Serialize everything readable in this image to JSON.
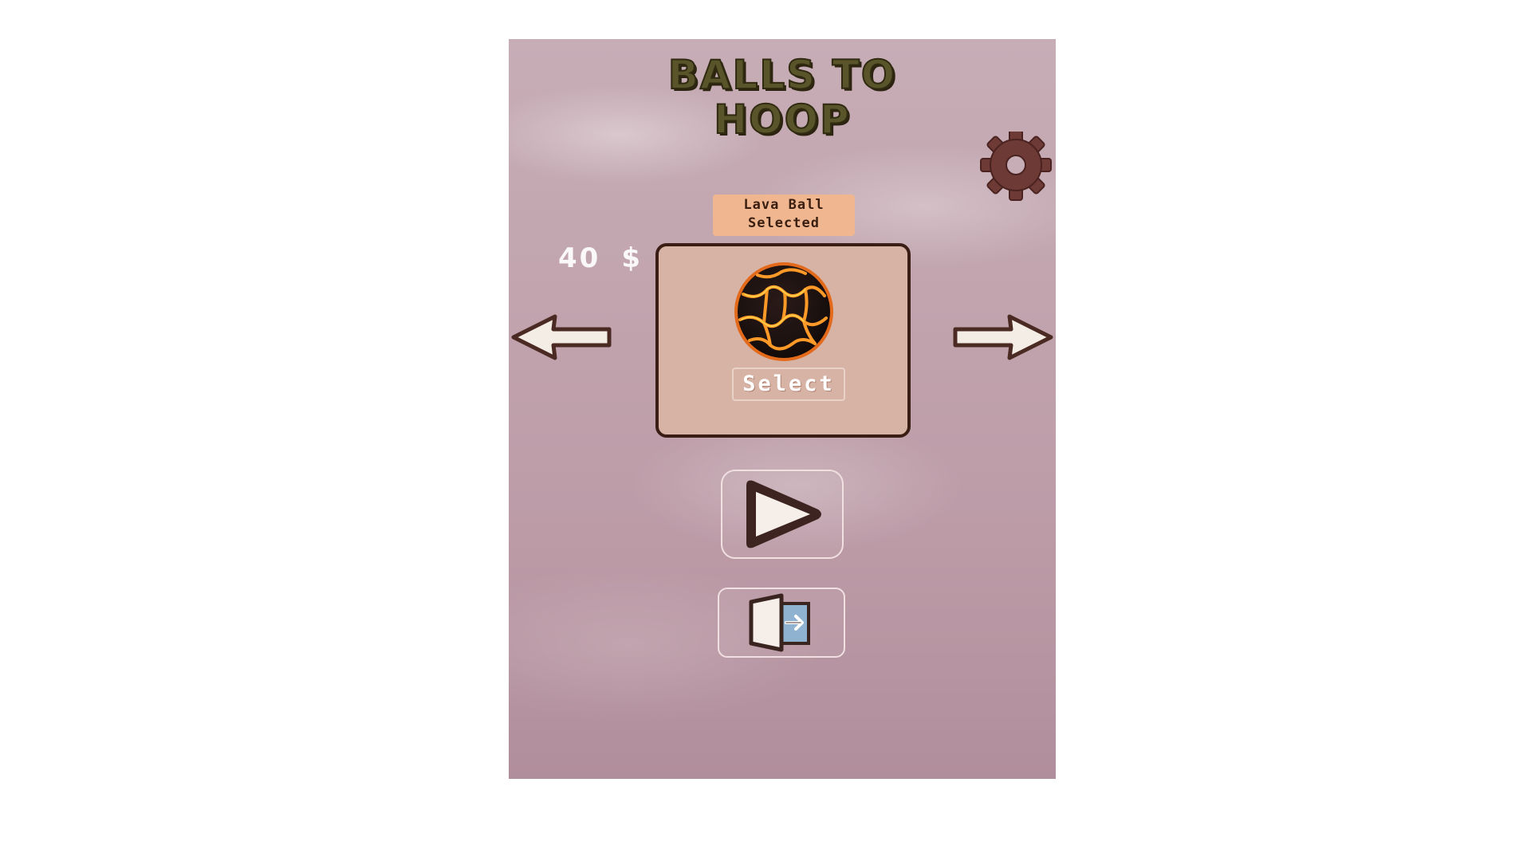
{
  "game": {
    "title_line1": "BALLS TO",
    "title_line2": "HOOP"
  },
  "currency": {
    "amount": "40",
    "symbol": "$"
  },
  "ball_selector": {
    "badge_line1": "Lava Ball",
    "badge_line2": "Selected",
    "ball_name": "Lava Ball",
    "select_label": "Select"
  },
  "icons": {
    "settings": "gear-icon",
    "prev": "arrow-left-icon",
    "next": "arrow-right-icon",
    "play": "play-icon",
    "exit": "exit-door-icon"
  },
  "colors": {
    "title": "#59542a",
    "card": "#d7b3a5",
    "card_border": "#3a1e16",
    "badge": "#f0b690",
    "gear": "#6e3a36",
    "background": "#c1a4ae"
  }
}
